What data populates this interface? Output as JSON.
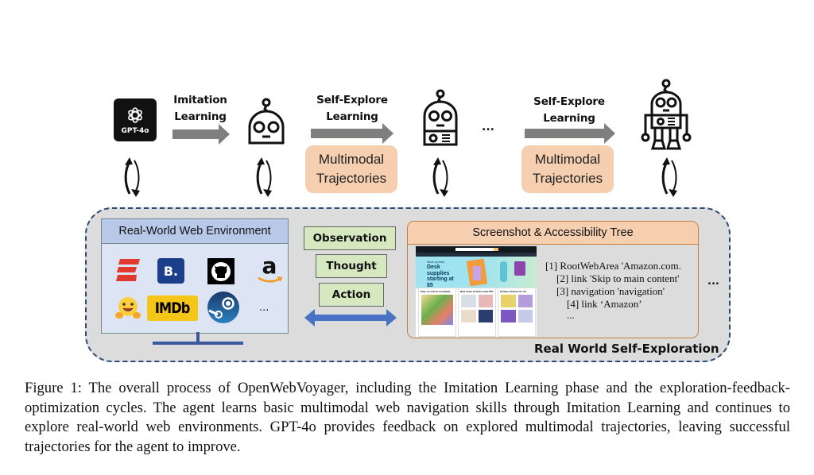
{
  "figure": {
    "top_row": {
      "gpt_label": "GPT-4o",
      "stage1": {
        "line1": "Imitation",
        "line2": "Learning"
      },
      "stage2": {
        "line1": "Self-Explore",
        "line2": "Learning",
        "box_line1": "Multimodal",
        "box_line2": "Trajectories"
      },
      "ellipsis": "...",
      "stage3": {
        "line1": "Self-Explore",
        "line2": "Learning",
        "box_line1": "Multimodal",
        "box_line2": "Trajectories"
      }
    },
    "environment": {
      "title": "Real-World Web Environment",
      "sites": [
        "espn-logo",
        "booking-logo",
        "github-logo",
        "amazon-logo",
        "huggingface-logo",
        "imdb-logo",
        "steam-logo"
      ],
      "imdb_text": "IMDb",
      "booking_text": "B.",
      "more": "..."
    },
    "loop": {
      "observation": "Observation",
      "thought": "Thought",
      "action": "Action"
    },
    "perception": {
      "title": "Screenshot & Accessibility Tree",
      "screenshot_banner_small": "Stock up early",
      "screenshot_banner_big": "Desk supplies starting at $5",
      "screenshot_cards": [
        "Save on school essentials",
        "New home arrivals under $50",
        "Summer fashion for all"
      ],
      "tree": [
        "[1] RootWebArea 'Amazon.com.",
        "[2] link 'Skip to main content'",
        "[3] navigation 'navigation'",
        "[4] link ‘Amazon’",
        "..."
      ],
      "more": "..."
    },
    "section_label": "Real World Self-Exploration",
    "colors": {
      "trajectory_box": "#f6cfb0",
      "green_box": "#d5e8bf",
      "monitor_bg": "#dde4f4",
      "monitor_header": "#b8c8e8",
      "outer_bg": "#dcdcdc",
      "dashed_border": "#2e4a72",
      "double_arrow": "#4a72c4",
      "gray_arrow": "#7f7f7f"
    }
  },
  "caption": "Figure 1: The overall process of OpenWebVoyager, including the Imitation Learning phase and the exploration-feedback-optimization cycles. The agent learns basic multimodal web navigation skills through Imitation Learning and continues to explore real-world web environments.  GPT-4o provides feedback on explored multimodal trajectories, leaving successful trajectories for the agent to improve."
}
